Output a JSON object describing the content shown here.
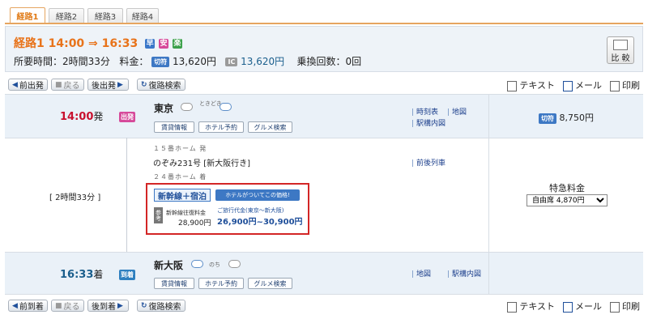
{
  "tabs": [
    "経路1",
    "経路2",
    "経路3",
    "経路4"
  ],
  "summary": {
    "title": "経路1 14:00 ⇒ 16:33",
    "badges": [
      {
        "t": "早",
        "c": "#3a77c9"
      },
      {
        "t": "安",
        "c": "#d64a9a"
      },
      {
        "t": "楽",
        "c": "#3ba04a"
      }
    ],
    "duration_label": "所要時間：2時間33分",
    "fare_label": "料金：",
    "ticket_tag": "切符",
    "ticket_price": "13,620円",
    "ic_tag": "IC",
    "ic_price": "13,620円",
    "transfers": "乗換回数：0回",
    "compare_label": "比 較"
  },
  "nav_top": {
    "prev": "前出発",
    "back": "戻る",
    "next": "後出発",
    "return": "復路検索"
  },
  "nav_bottom": {
    "prev": "前到着",
    "back": "戻る",
    "next": "後到着",
    "return": "復路検索"
  },
  "tools": {
    "text": "テキスト",
    "mail": "メール",
    "print": "印刷"
  },
  "departure": {
    "time": "14:00",
    "unit": "発",
    "tag": "出発",
    "station": "東京",
    "weather_note": "ときどき",
    "buttons": [
      "賃貸情報",
      "ホテル予約",
      "グルメ検索"
    ],
    "links": [
      "時刻表",
      "地図",
      "駅構内図"
    ],
    "fare_tag": "切符",
    "fare": "8,750円"
  },
  "segment": {
    "duration": "[ 2時間33分 ]",
    "platform_from": "１５番ホーム 発",
    "train": "のぞみ231号 [新大阪行き]",
    "platform_to": "２４番ホーム 着",
    "link": "前後列車",
    "promo_badge": "新幹線＋宿泊",
    "promo_bubble": "ホテルがついてこの価格!",
    "ref_tag": "参考",
    "roundtrip_label": "新幹線往復料金",
    "roundtrip_price": "28,900円",
    "agency_label": "ご旅行代金(東京～新大阪)",
    "agency_price": "26,900円~30,900円",
    "express_label": "特急料金",
    "seat_option": "自由席 4,870円"
  },
  "arrival": {
    "time": "16:33",
    "unit": "着",
    "tag": "到着",
    "station": "新大阪",
    "weather_note": "のち",
    "buttons": [
      "賃貸情報",
      "ホテル予約",
      "グルメ検索"
    ],
    "links": [
      "地図",
      "駅構内図"
    ]
  },
  "colors": {
    "accent": "#e8731a",
    "time_dep": "#c8102e",
    "time_arr": "#1a5e8c",
    "promo_border": "#d32626",
    "link": "#1c3f8c"
  }
}
